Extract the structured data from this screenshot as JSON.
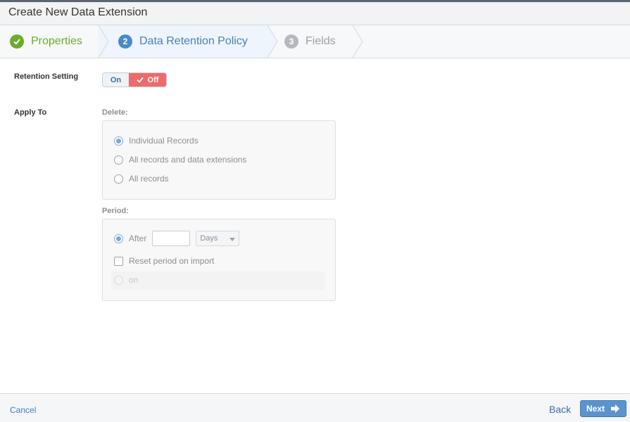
{
  "window": {
    "title": "Create New Data Extension"
  },
  "steps": [
    {
      "label": "Properties",
      "state": "complete"
    },
    {
      "number": "2",
      "label": "Data Retention Policy",
      "state": "active"
    },
    {
      "number": "3",
      "label": "Fields",
      "state": "upcoming"
    }
  ],
  "retention": {
    "label": "Retention Setting",
    "on_label": "On",
    "off_label": "Off",
    "selected": "Off"
  },
  "apply_to": {
    "label": "Apply To",
    "delete_label": "Delete:",
    "delete_options": [
      "Individual Records",
      "All records and data extensions",
      "All records"
    ],
    "delete_selected": "Individual Records",
    "period_label": "Period:",
    "after_label": "After",
    "after_value": "",
    "unit_selected": "Days",
    "reset_label": "Reset period on import",
    "on_label": "on"
  },
  "footer": {
    "cancel_label": "Cancel",
    "back_label": "Back",
    "next_label": "Next"
  },
  "colors": {
    "complete": "#6aad2a",
    "active": "#4a8ac9",
    "off_toggle": "#ee6b6b",
    "primary_button": "#5a94cf"
  }
}
